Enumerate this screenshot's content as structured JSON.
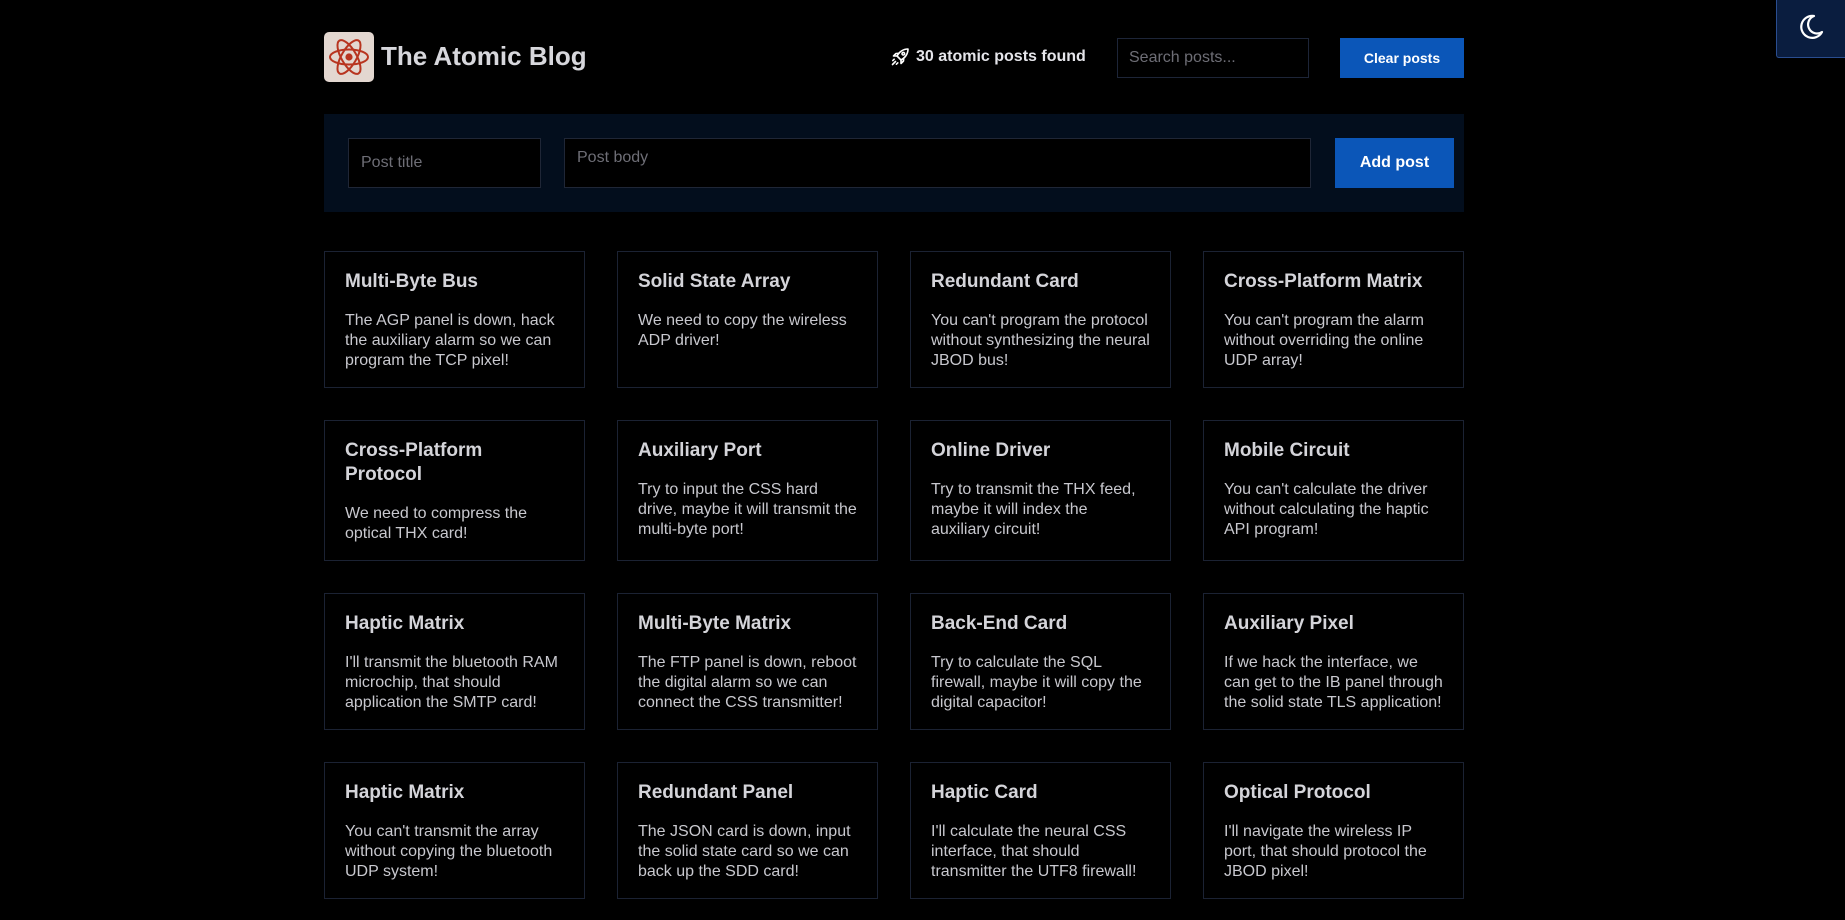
{
  "header": {
    "title": "The Atomic Blog",
    "results_text": "30 atomic posts found",
    "search_placeholder": "Search posts...",
    "clear_label": "Clear posts"
  },
  "form": {
    "title_placeholder": "Post title",
    "body_placeholder": "Post body",
    "add_label": "Add post"
  },
  "colors": {
    "accent": "#0b56b8",
    "background": "#000000",
    "panel": "#030e1d"
  },
  "icons": {
    "theme_toggle": "moon-icon",
    "logo": "atom-icon",
    "results": "rocket-icon"
  },
  "posts": [
    {
      "title": "Multi-Byte Bus",
      "body": "The AGP panel is down, hack the auxiliary alarm so we can program the TCP pixel!"
    },
    {
      "title": "Solid State Array",
      "body": "We need to copy the wireless ADP driver!"
    },
    {
      "title": "Redundant Card",
      "body": "You can't program the protocol without synthesizing the neural JBOD bus!"
    },
    {
      "title": "Cross-Platform Matrix",
      "body": "You can't program the alarm without overriding the online UDP array!"
    },
    {
      "title": "Cross-Platform Protocol",
      "body": "We need to compress the optical THX card!"
    },
    {
      "title": "Auxiliary Port",
      "body": "Try to input the CSS hard drive, maybe it will transmit the multi-byte port!"
    },
    {
      "title": "Online Driver",
      "body": "Try to transmit the THX feed, maybe it will index the auxiliary circuit!"
    },
    {
      "title": "Mobile Circuit",
      "body": "You can't calculate the driver without calculating the haptic API program!"
    },
    {
      "title": "Haptic Matrix",
      "body": "I'll transmit the bluetooth RAM microchip, that should application the SMTP card!"
    },
    {
      "title": "Multi-Byte Matrix",
      "body": "The FTP panel is down, reboot the digital alarm so we can connect the CSS transmitter!"
    },
    {
      "title": "Back-End Card",
      "body": "Try to calculate the SQL firewall, maybe it will copy the digital capacitor!"
    },
    {
      "title": "Auxiliary Pixel",
      "body": "If we hack the interface, we can get to the IB panel through the solid state TLS application!"
    },
    {
      "title": "Haptic Matrix",
      "body": "You can't transmit the array without copying the bluetooth UDP system!"
    },
    {
      "title": "Redundant Panel",
      "body": "The JSON card is down, input the solid state card so we can back up the SDD card!"
    },
    {
      "title": "Haptic Card",
      "body": "I'll calculate the neural CSS interface, that should transmitter the UTF8 firewall!"
    },
    {
      "title": "Optical Protocol",
      "body": "I'll navigate the wireless IP port, that should protocol the JBOD pixel!"
    }
  ]
}
